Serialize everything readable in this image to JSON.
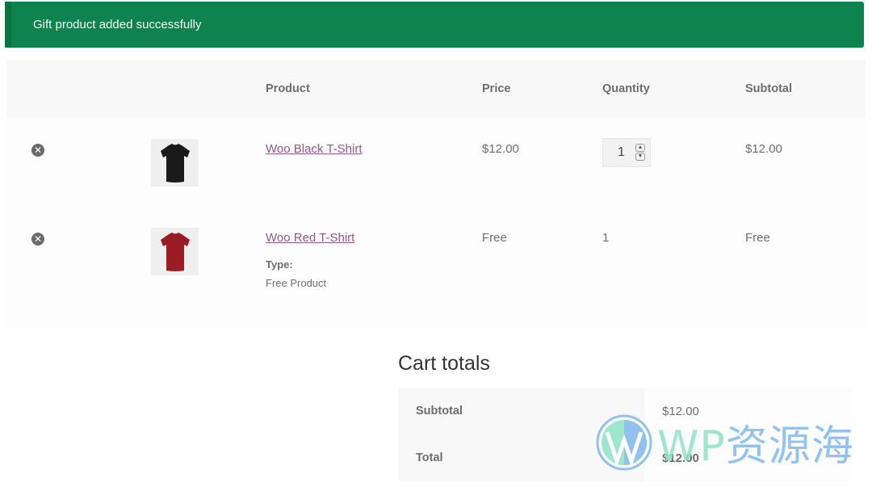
{
  "notice": {
    "message": "Gift product added successfully",
    "bg_color": "#0f834d"
  },
  "cart": {
    "headers": {
      "remove": "",
      "thumbnail": "",
      "product": "Product",
      "price": "Price",
      "quantity": "Quantity",
      "subtotal": "Subtotal"
    },
    "items": [
      {
        "remove_icon": "close-circle-icon",
        "thumbnail": "black-tshirt-image",
        "name": "Woo Black T-Shirt",
        "price": "$12.00",
        "quantity": "1",
        "quantity_editable": true,
        "subtotal": "$12.00"
      },
      {
        "remove_icon": "close-circle-icon",
        "thumbnail": "red-tshirt-image",
        "name": "Woo Red T-Shirt",
        "meta_label": "Type:",
        "meta_value": "Free Product",
        "price": "Free",
        "quantity": "1",
        "quantity_editable": false,
        "subtotal": "Free"
      }
    ],
    "link_color": "#96588a"
  },
  "totals": {
    "title": "Cart totals",
    "rows": [
      {
        "label": "Subtotal",
        "value": "$12.00"
      },
      {
        "label": "Total",
        "value": "$12.00"
      }
    ]
  },
  "watermark": {
    "latin": "WP",
    "cjk": "资源海"
  }
}
